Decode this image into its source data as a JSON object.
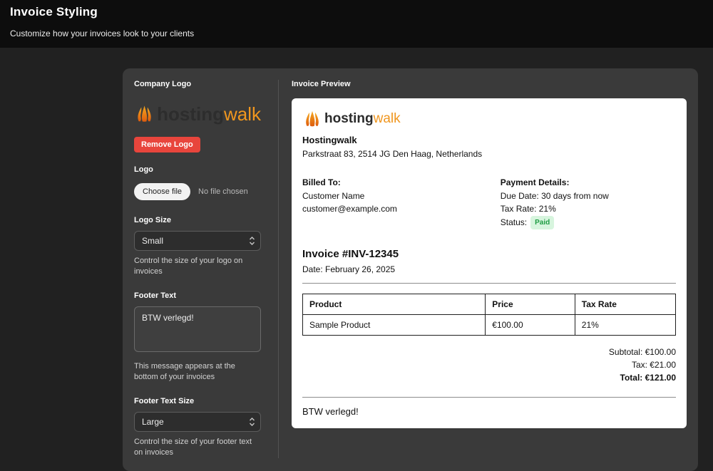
{
  "page": {
    "title": "Invoice Styling",
    "subtitle": "Customize how your invoices look to your clients"
  },
  "logo_settings": {
    "section_label": "Company Logo",
    "brand_first": "hosting",
    "brand_second": "walk",
    "remove_logo_button": "Remove Logo",
    "logo_field_label": "Logo",
    "choose_file_button": "Choose file",
    "file_status": "No file chosen",
    "logo_size_label": "Logo Size",
    "logo_size_value": "Small",
    "logo_size_help": "Control the size of your logo on invoices",
    "footer_text_label": "Footer Text",
    "footer_text_value": "BTW verlegd!",
    "footer_text_help": "This message appears at the bottom of your invoices",
    "footer_size_label": "Footer Text Size",
    "footer_size_value": "Large",
    "footer_size_help": "Control the size of your footer text on invoices"
  },
  "preview": {
    "section_label": "Invoice Preview",
    "brand_first": "hosting",
    "brand_second": "walk",
    "company_name": "Hostingwalk",
    "company_address": "Parkstraat 83, 2514 JG Den Haag, Netherlands",
    "billed_to_label": "Billed To:",
    "customer_name": "Customer Name",
    "customer_email": "customer@example.com",
    "payment_details_label": "Payment Details:",
    "due_date": "Due Date: 30 days from now",
    "tax_rate": "Tax Rate: 21%",
    "status_label": "Status:",
    "status_badge": "Paid",
    "invoice_number": "Invoice #INV-12345",
    "invoice_date": "Date: February 26, 2025",
    "table": {
      "headers": [
        "Product",
        "Price",
        "Tax Rate"
      ],
      "rows": [
        [
          "Sample Product",
          "€100.00",
          "21%"
        ]
      ]
    },
    "totals": {
      "subtotal": "Subtotal: €100.00",
      "tax": "Tax: €21.00",
      "total": "Total: €121.00"
    },
    "footer_text": "BTW verlegd!"
  },
  "colors": {
    "accent_orange": "#f0961e",
    "danger_red": "#e8453c",
    "paid_badge_bg": "#d7f5de",
    "paid_badge_text": "#1f9d44"
  }
}
